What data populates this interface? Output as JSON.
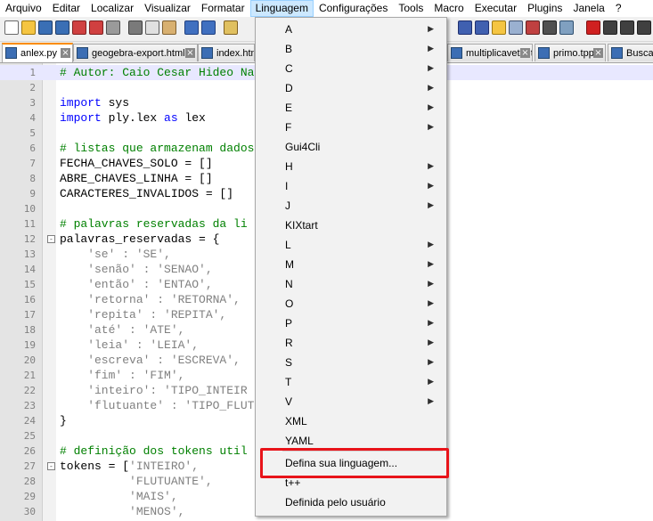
{
  "menubar": {
    "items": [
      "Arquivo",
      "Editar",
      "Localizar",
      "Visualizar",
      "Formatar",
      "Linguagem",
      "Configurações",
      "Tools",
      "Macro",
      "Executar",
      "Plugins",
      "Janela",
      "?"
    ],
    "active_index": 5
  },
  "tabs": [
    {
      "label": "anlex.py",
      "active": true
    },
    {
      "label": "geogebra-export.html",
      "active": false
    },
    {
      "label": "index.htm",
      "active": false
    },
    {
      "label": "multiplicavetor.tpp",
      "active": false
    },
    {
      "label": "primo.tpp",
      "active": false
    },
    {
      "label": "Busca",
      "active": false
    }
  ],
  "code_lines": [
    {
      "n": "1",
      "tokens": [
        {
          "t": "# Autor: Caio Cesar Hideo Na",
          "c": "comment"
        }
      ],
      "current": true
    },
    {
      "n": "2",
      "tokens": []
    },
    {
      "n": "3",
      "tokens": [
        {
          "t": "import",
          "c": "kw"
        },
        {
          "t": " sys",
          "c": "plain"
        }
      ]
    },
    {
      "n": "4",
      "tokens": [
        {
          "t": "import",
          "c": "kw"
        },
        {
          "t": " ply.lex ",
          "c": "plain"
        },
        {
          "t": "as",
          "c": "kw"
        },
        {
          "t": " lex",
          "c": "plain"
        }
      ]
    },
    {
      "n": "5",
      "tokens": []
    },
    {
      "n": "6",
      "tokens": [
        {
          "t": "# listas que armazenam dados",
          "c": "comment"
        }
      ]
    },
    {
      "n": "7",
      "tokens": [
        {
          "t": "FECHA_CHAVES_SOLO = []",
          "c": "plain"
        }
      ]
    },
    {
      "n": "8",
      "tokens": [
        {
          "t": "ABRE_CHAVES_LINHA = []",
          "c": "plain"
        }
      ]
    },
    {
      "n": "9",
      "tokens": [
        {
          "t": "CARACTERES_INVALIDOS = []",
          "c": "plain"
        }
      ]
    },
    {
      "n": "10",
      "tokens": []
    },
    {
      "n": "11",
      "tokens": [
        {
          "t": "# palavras reservadas da li",
          "c": "comment"
        }
      ]
    },
    {
      "n": "12",
      "tokens": [
        {
          "t": "palavras_reservadas = {",
          "c": "plain"
        }
      ],
      "fold": "-"
    },
    {
      "n": "13",
      "tokens": [
        {
          "t": "    'se' : 'SE',",
          "c": "str"
        }
      ]
    },
    {
      "n": "14",
      "tokens": [
        {
          "t": "    'senão' : 'SENAO',",
          "c": "str"
        }
      ]
    },
    {
      "n": "15",
      "tokens": [
        {
          "t": "    'então' : 'ENTAO',",
          "c": "str"
        }
      ]
    },
    {
      "n": "16",
      "tokens": [
        {
          "t": "    'retorna' : 'RETORNA',",
          "c": "str"
        }
      ]
    },
    {
      "n": "17",
      "tokens": [
        {
          "t": "    'repita' : 'REPITA',",
          "c": "str"
        }
      ]
    },
    {
      "n": "18",
      "tokens": [
        {
          "t": "    'até' : 'ATE',",
          "c": "str"
        }
      ]
    },
    {
      "n": "19",
      "tokens": [
        {
          "t": "    'leia' : 'LEIA',",
          "c": "str"
        }
      ]
    },
    {
      "n": "20",
      "tokens": [
        {
          "t": "    'escreva' : 'ESCREVA',",
          "c": "str"
        }
      ]
    },
    {
      "n": "21",
      "tokens": [
        {
          "t": "    'fim' : 'FIM',",
          "c": "str"
        }
      ]
    },
    {
      "n": "22",
      "tokens": [
        {
          "t": "    'inteiro': 'TIPO_INTEIR",
          "c": "str"
        }
      ]
    },
    {
      "n": "23",
      "tokens": [
        {
          "t": "    'flutuante' : 'TIPO_FLUT",
          "c": "str"
        }
      ]
    },
    {
      "n": "24",
      "tokens": [
        {
          "t": "}",
          "c": "plain"
        }
      ]
    },
    {
      "n": "25",
      "tokens": []
    },
    {
      "n": "26",
      "tokens": [
        {
          "t": "# definição dos tokens util",
          "c": "comment"
        }
      ]
    },
    {
      "n": "27",
      "tokens": [
        {
          "t": "tokens = [",
          "c": "plain"
        },
        {
          "t": "'INTEIRO',",
          "c": "str"
        }
      ],
      "fold": "-"
    },
    {
      "n": "28",
      "tokens": [
        {
          "t": "          'FLUTUANTE',",
          "c": "str"
        }
      ]
    },
    {
      "n": "29",
      "tokens": [
        {
          "t": "          'MAIS',",
          "c": "str"
        }
      ]
    },
    {
      "n": "30",
      "tokens": [
        {
          "t": "          'MENOS',",
          "c": "str"
        }
      ]
    }
  ],
  "language_menu": {
    "items": [
      {
        "label": "A",
        "submenu": true
      },
      {
        "label": "B",
        "submenu": true
      },
      {
        "label": "C",
        "submenu": true
      },
      {
        "label": "D",
        "submenu": true
      },
      {
        "label": "E",
        "submenu": true
      },
      {
        "label": "F",
        "submenu": true
      },
      {
        "label": "Gui4Cli",
        "submenu": false
      },
      {
        "label": "H",
        "submenu": true
      },
      {
        "label": "I",
        "submenu": true
      },
      {
        "label": "J",
        "submenu": true
      },
      {
        "label": "KIXtart",
        "submenu": false
      },
      {
        "label": "L",
        "submenu": true
      },
      {
        "label": "M",
        "submenu": true
      },
      {
        "label": "N",
        "submenu": true
      },
      {
        "label": "O",
        "submenu": true
      },
      {
        "label": "P",
        "submenu": true
      },
      {
        "label": "R",
        "submenu": true
      },
      {
        "label": "S",
        "submenu": true
      },
      {
        "label": "T",
        "submenu": true
      },
      {
        "label": "V",
        "submenu": true
      },
      {
        "label": "XML",
        "submenu": false
      },
      {
        "label": "YAML",
        "submenu": false
      },
      {
        "label": "Defina sua linguagem...",
        "submenu": false,
        "highlighted": true
      },
      {
        "label": "t++",
        "submenu": false
      },
      {
        "label": "Definida pelo usuário",
        "submenu": false
      }
    ],
    "highlight_color": "#e8141a"
  }
}
